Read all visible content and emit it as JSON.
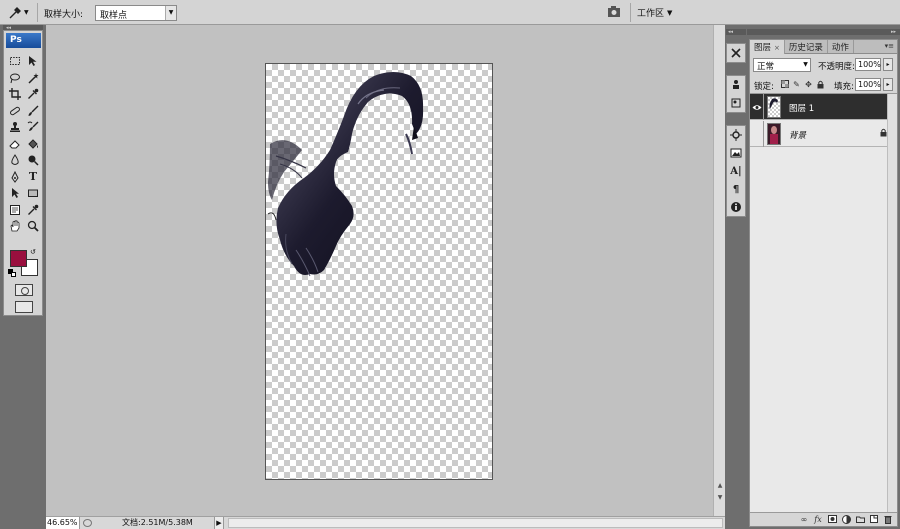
{
  "options_bar": {
    "tool_icon": "eyedropper-icon",
    "sample_size_label": "取样大小:",
    "sample_size_value": "取样点",
    "workspace_icon": "workspace-switch-icon",
    "workspace_label": "工作区",
    "workspace_arrow": "▼"
  },
  "toolbox": {
    "logo": "Ps",
    "tools": [
      "marquee-icon",
      "move-icon",
      "lasso-icon",
      "magic-wand-icon",
      "crop-icon",
      "eyedropper-icon",
      "spot-healing-icon",
      "brush-icon",
      "clone-stamp-icon",
      "history-brush-icon",
      "eraser-icon",
      "paint-bucket-icon",
      "blur-icon",
      "dodge-icon",
      "pen-icon",
      "type-icon",
      "path-select-icon",
      "rectangle-shape-icon",
      "notes-icon",
      "eyedropper-2-icon",
      "hand-icon",
      "zoom-icon"
    ],
    "type_tool_glyph": "T",
    "foreground_color": "#9a0f3e",
    "background_color": "#ffffff"
  },
  "status_bar": {
    "zoom": "46.65%",
    "doc_info": "文档:2.51M/5.38M"
  },
  "layers_panel": {
    "tabs": [
      {
        "label": "图层",
        "active": true,
        "closable": true
      },
      {
        "label": "历史记录",
        "active": false,
        "closable": false
      },
      {
        "label": "动作",
        "active": false,
        "closable": false
      }
    ],
    "close_glyph": "×",
    "blend_mode": "正常",
    "opacity_label": "不透明度:",
    "opacity_value": "100%",
    "lock_label": "锁定:",
    "fill_label": "填充:",
    "fill_value": "100%",
    "layers": [
      {
        "name": "图层 1",
        "selected": true,
        "visible": true,
        "locked": false
      },
      {
        "name": "背景",
        "selected": false,
        "visible": false,
        "locked": true
      }
    ]
  },
  "colors": {
    "accent_selected_layer": "#2e2e2e",
    "workspace_gray": "#c1c1c1",
    "foreground_swatch": "#9a0f3e"
  }
}
